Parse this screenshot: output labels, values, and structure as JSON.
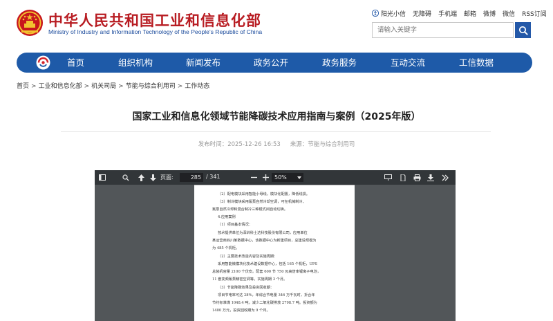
{
  "header": {
    "title_cn": "中华人民共和国工业和信息化部",
    "title_en": "Ministry of Industry and Information Technology of the People's Republic of China",
    "emblem_icon": "national-emblem-icon",
    "top_links": [
      "阳光小信",
      "无障碍",
      "手机端",
      "邮箱",
      "微博",
      "微信",
      "RSS订阅"
    ]
  },
  "search": {
    "placeholder": "请输入关键字"
  },
  "nav": {
    "logo_icon": "miit-logo-icon",
    "items": [
      "首页",
      "组织机构",
      "新闻发布",
      "政务公开",
      "政务服务",
      "互动交流",
      "工信数据"
    ]
  },
  "breadcrumb": [
    "首页",
    "工业和信息化部",
    "机关司局",
    "节能与综合利用司",
    "工作动态"
  ],
  "article": {
    "title": "国家工业和信息化领域节能降碳技术应用指南与案例（2025年版）",
    "publish_time": "发布时间：2025-12-26 16:53",
    "source": "来源：节能与综合利用司"
  },
  "pdf": {
    "page_label": "页面:",
    "current_page": "285",
    "total_pages": "/ 341",
    "zoom": "50%",
    "lines": [
      "（2）配电模块采用智能小母线，模块化配置，降低线损。",
      "（3）制冷模块采用氟泵自然冷却空调，可在机械制冷、",
      "氟泵自然冷却和混合制冷三种模式间自动切换。",
      "4.应用案例",
      "（1）项目基本情况：",
      "技术提供单位为深圳科士达科技股份有限公司，应用单位",
      "某运营商四川某数据中心，该数据中心为新建项目，总建设规模为",
      "为 485 个机柜。",
      "（2）主要技术改造内容及实施周期：",
      "采用智能微模块化技术建设数据中心，包括 165 个机柜，UPS",
      "总装机容量 2100 个伏安。配套 600 节 750 瓦高倍率锂离子电池，",
      "11 套变频氟泵精密空调等。实施周期 3 个月。",
      "（3）节能降碳效果及投资回收期：",
      "项目节电率可达 28%，年综合节电量 346 万千瓦时，折合年",
      "节约标准煤 1048.4 吨，减少二氧化碳排放 2798.7 吨。投资额为",
      "1400 万元，投资回收期为 9 个月。"
    ]
  }
}
